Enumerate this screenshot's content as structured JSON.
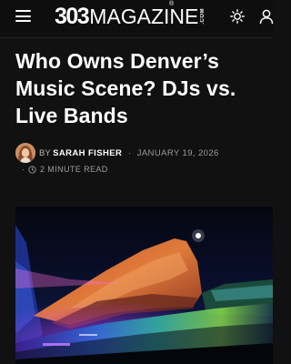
{
  "header": {
    "menu_icon": "hamburger-menu-icon",
    "logo_number": "303",
    "logo_word": "MAGAZINE",
    "logo_suffix": ".COM",
    "logo_registered": "®",
    "theme_icon": "sun-icon",
    "profile_icon": "user-profile-icon"
  },
  "article": {
    "title": "Who Owns Denver’s Music Scene? DJs vs. Live Bands",
    "byline_prefix": "BY",
    "author": "SARAH FISHER",
    "separator": "·",
    "date": "JANUARY 19, 2026",
    "read_separator": "·",
    "read_time": "2 MINUTE READ",
    "clock_icon": "clock-icon"
  },
  "colors": {
    "background": "#111111",
    "text": "#ffffff",
    "meta": "#9c9c9c"
  }
}
